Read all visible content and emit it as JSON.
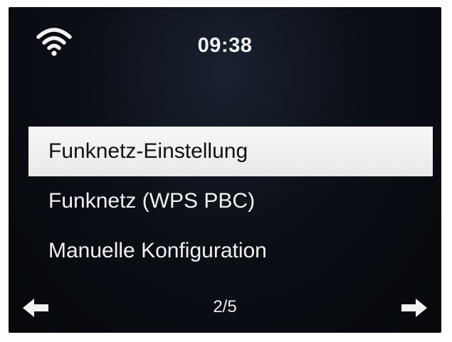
{
  "status": {
    "wifi_icon": "wifi-icon",
    "time": "09:38"
  },
  "menu": {
    "items": [
      {
        "label": "Funknetz-Einstellung",
        "selected": true
      },
      {
        "label": "Funknetz (WPS PBC)",
        "selected": false
      },
      {
        "label": "Manuelle Konfiguration",
        "selected": false
      }
    ]
  },
  "pager": {
    "page_label": "2/5",
    "prev_icon": "arrow-left-icon",
    "next_icon": "arrow-right-icon"
  },
  "colors": {
    "screen_background": "#0b0f16",
    "text": "#f2f2f2",
    "selection_background": "#f2f2f2",
    "selection_text": "#111111"
  }
}
